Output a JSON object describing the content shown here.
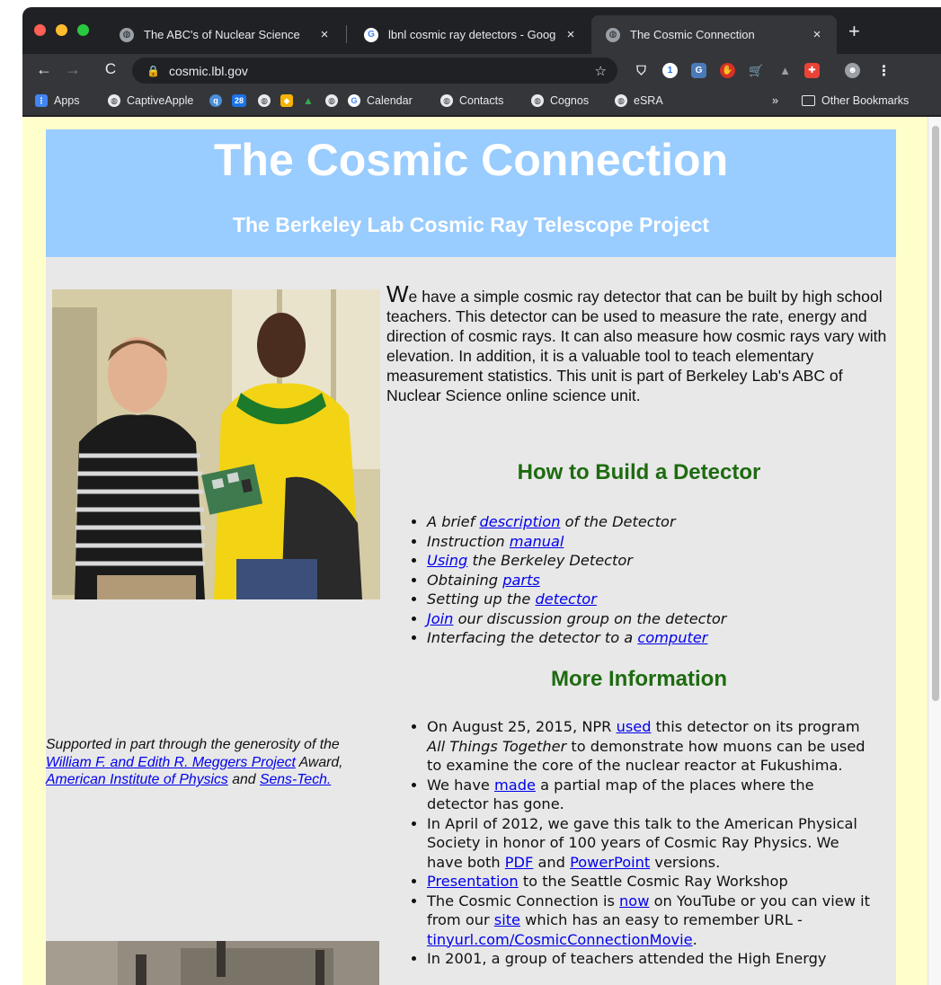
{
  "browser": {
    "tabs": [
      {
        "title": "The ABC's of Nuclear Science",
        "icon": "globe-icon"
      },
      {
        "title": "lbnl cosmic ray detectors - Goog",
        "icon": "google-icon"
      },
      {
        "title": "The Cosmic Connection",
        "icon": "globe-icon",
        "active": true
      }
    ],
    "close_glyph": "×",
    "new_tab_glyph": "+",
    "address": "cosmic.lbl.gov",
    "bookmarks": [
      "Apps",
      "CaptiveApple",
      "28",
      "Calendar",
      "Contacts",
      "Cognos",
      "eSRA"
    ],
    "overflow": "»",
    "other_bookmarks": "Other Bookmarks"
  },
  "page": {
    "title": "The Cosmic Connection",
    "subtitle": "The Berkeley Lab Cosmic Ray Telescope Project",
    "intro": {
      "dropcap": "W",
      "text": "e have a simple cosmic ray detector that can be built by high school teachers. This detector can be used to measure the rate, energy and direction of cosmic rays. It can also measure how cosmic rays vary with elevation. In addition, it is a valuable tool to teach elementary measurement statistics. This unit is part of Berkeley Lab's ABC of Nuclear Science online science unit."
    },
    "build": {
      "heading": "How to Build a Detector",
      "items": [
        {
          "pre": "A brief ",
          "link": "description",
          "post": " of the Detector"
        },
        {
          "pre": "Instruction ",
          "link": "manual",
          "post": ""
        },
        {
          "pre": "",
          "link": "Using",
          "post": " the Berkeley Detector"
        },
        {
          "pre": "Obtaining ",
          "link": "parts",
          "post": ""
        },
        {
          "pre": "Setting up the ",
          "link": "detector",
          "post": ""
        },
        {
          "pre": "",
          "link": "Join",
          "post": " our discussion group on the detector"
        },
        {
          "pre": "Interfacing the detector to a ",
          "link": "computer",
          "post": ""
        }
      ]
    },
    "more": {
      "heading": "More Information",
      "items": {
        "npr_pre": "On August 25, 2015, NPR ",
        "npr_link": "used",
        "npr_mid": " this detector on its program ",
        "npr_show": "All Things Together",
        "npr_post": " to demonstrate how muons can be used to examine the core of the nuclear reactor at Fukushima.",
        "map_pre": "We have ",
        "map_link": "made",
        "map_post": " a partial map of the places where the detector has gone.",
        "aps_pre": "In April of 2012, we gave this talk to the American Physical Society in honor of 100 years of Cosmic Ray Physics. We have both ",
        "aps_pdf": "PDF",
        "aps_and": " and ",
        "aps_ppt": "PowerPoint",
        "aps_post": " versions.",
        "pres_link": "Presentation",
        "pres_post": " to the Seattle Cosmic Ray Workshop",
        "yt_pre": "The Cosmic Connection is ",
        "yt_now": "now",
        "yt_mid": " on YouTube or you can view it from our ",
        "yt_site": "site",
        "yt_mid2": " which has an easy to remember URL - ",
        "yt_url": "tinyurl.com/CosmicConnectionMovie",
        "yt_post": ".",
        "teachers": "In 2001, a group of teachers attended the High Energy"
      }
    },
    "support": {
      "pre": "Supported in part through the generosity of the ",
      "link1": "William F. and Edith R. Meggers Project",
      "mid1": " Award, ",
      "link2": "American Institute of Physics",
      "mid2": " and ",
      "link3": "Sens-Tech."
    }
  }
}
